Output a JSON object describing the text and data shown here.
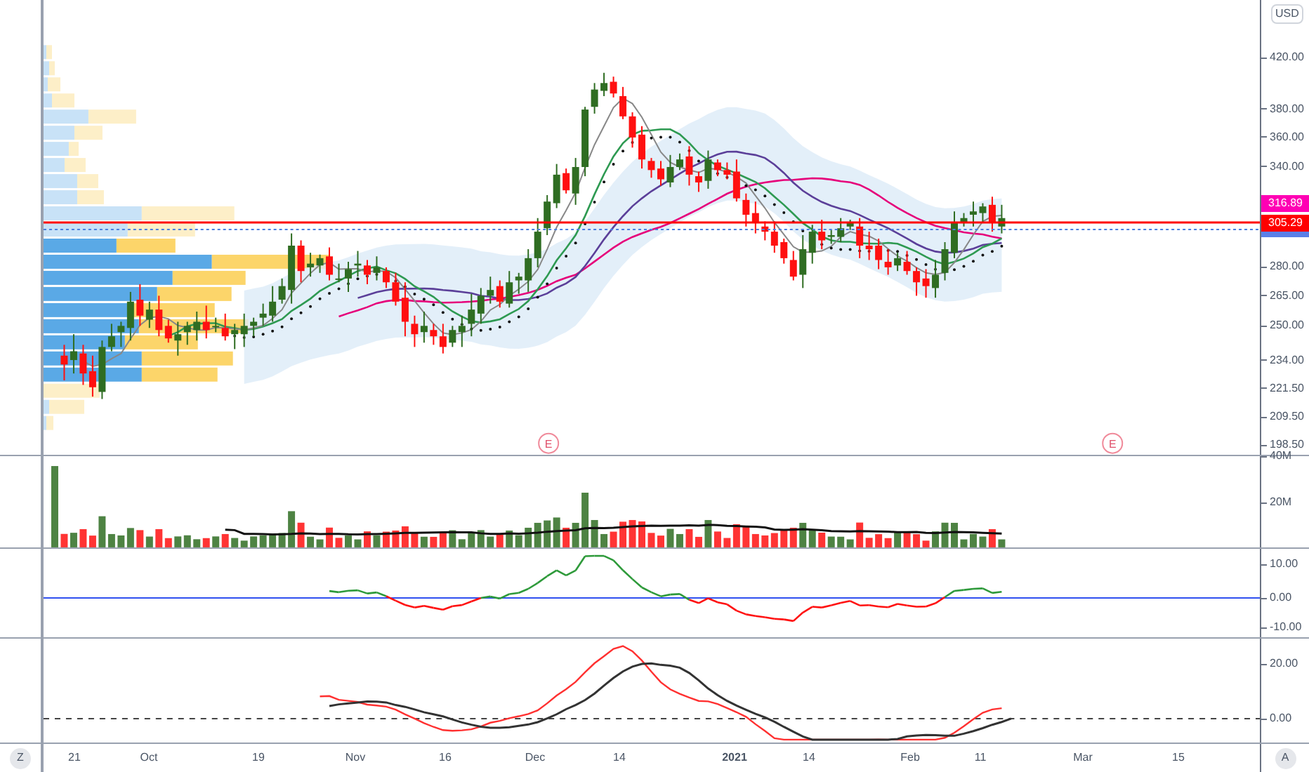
{
  "price_axis": {
    "currency": "USD",
    "ticks": [
      "420.00",
      "380.00",
      "360.00",
      "340.00",
      "280.00",
      "265.00",
      "250.00",
      "234.00",
      "221.50",
      "209.50",
      "198.50"
    ],
    "badges": [
      {
        "value": "316.89",
        "color": "#ff00b4"
      },
      {
        "value": "305.29",
        "color": "#ff0000"
      }
    ]
  },
  "earnings_markers": [
    "E",
    "E"
  ],
  "volume_axis": {
    "ticks": [
      "40M",
      "20M"
    ]
  },
  "oscillator_axis": {
    "ticks": [
      "10.00",
      "0.00",
      "-10.00"
    ]
  },
  "momentum_axis": {
    "ticks": [
      "20.00",
      "0.00"
    ]
  },
  "time_axis": {
    "labels": [
      "21",
      "Oct",
      "19",
      "Nov",
      "16",
      "Dec",
      "14",
      "2021",
      "14",
      "Feb",
      "11",
      "Mar",
      "15"
    ]
  },
  "timezone_button": "Z",
  "auto_scale_button": "A"
}
